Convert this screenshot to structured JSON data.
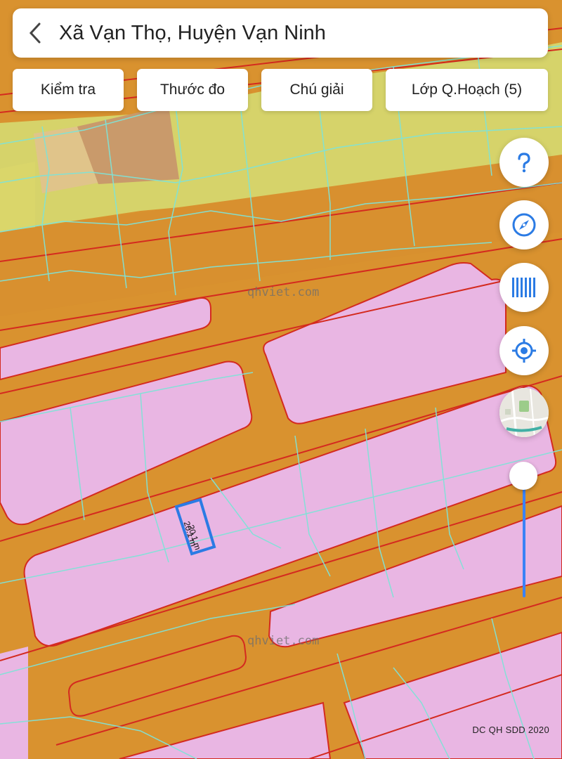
{
  "header": {
    "title": "Xã Vạn Thọ, Huyện Vạn Ninh",
    "back_icon": "back-arrow-icon"
  },
  "toolbar": {
    "buttons": [
      {
        "label": "Kiểm tra"
      },
      {
        "label": "Thước đo"
      },
      {
        "label": "Chú giải"
      },
      {
        "label": "Lớp Q.Hoạch (5)"
      }
    ]
  },
  "side_buttons": {
    "help_icon": "question-icon",
    "compass_icon": "compass-icon",
    "barcode_icon": "barcode-icon",
    "locate_icon": "target-location-icon",
    "basemap_icon": "map-thumbnail-icon"
  },
  "map": {
    "watermarks": [
      "qhviet.com",
      "qhviet.com"
    ],
    "measurement": {
      "side_a": "20.1 m",
      "side_b": "20.1 m"
    },
    "copyright": "DC QH SDD 2020",
    "colors": {
      "planned_road": "#d9922f",
      "residential": "#e7b4e4",
      "agricultural": "#d8d56a",
      "boundary_red": "#d42a1f",
      "parcel_cyan": "#7fe3d7",
      "measure_blue": "#2b7be4"
    }
  },
  "zoom_slider": {
    "level": 0.0
  }
}
